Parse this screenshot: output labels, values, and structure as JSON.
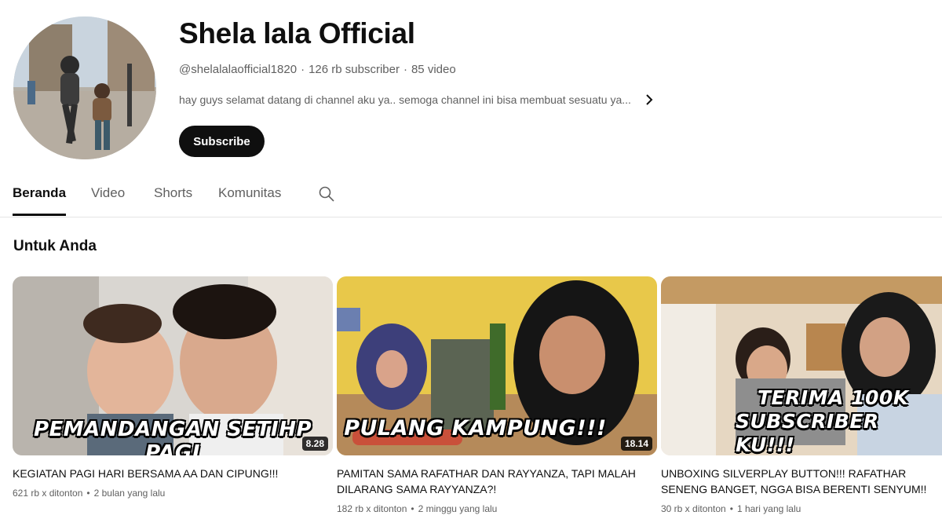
{
  "channel": {
    "name": "Shela lala Official",
    "handle": "@shelalalaofficial1820",
    "subscribers": "126 rb subscriber",
    "video_count": "85 video",
    "meta_separator": "·",
    "description": "hay guys selamat datang di channel aku ya.. semoga channel ini bisa membuat sesuatu ya...",
    "subscribe_label": "Subscribe"
  },
  "tabs": [
    {
      "label": "Beranda",
      "active": true
    },
    {
      "label": "Video",
      "active": false
    },
    {
      "label": "Shorts",
      "active": false
    },
    {
      "label": "Komunitas",
      "active": false
    }
  ],
  "section": {
    "title": "Untuk Anda"
  },
  "videos": [
    {
      "thumb_text": "PEMANDANGAN SETIHP PAGI",
      "duration": "8.28",
      "title": "KEGIATAN PAGI HARI BERSAMA AA DAN CIPUNG!!!",
      "views": "621 rb x ditonton",
      "age": "2 bulan yang lalu"
    },
    {
      "thumb_text": "PULANG KAMPUNG!!!",
      "duration": "18.14",
      "title": "PAMITAN SAMA RAFATHAR DAN RAYYANZA, TAPI MALAH DILARANG SAMA RAYYANZA?!",
      "views": "182 rb x ditonton",
      "age": "2 minggu yang lalu"
    },
    {
      "thumb_text_line1": "TERIMA 100K",
      "thumb_text_line2": "SUBSCRIBER KU!!!",
      "title": "UNBOXING SILVERPLAY BUTTON!!! RAFATHAR SENENG BANGET, NGGA BISA BERENTI SENYUM!!",
      "views": "30 rb x ditonton",
      "age": "1 hari yang lalu"
    }
  ],
  "meta_dot": "•",
  "icons": {
    "search": "search-icon",
    "chevron": "chevron-right-icon"
  }
}
